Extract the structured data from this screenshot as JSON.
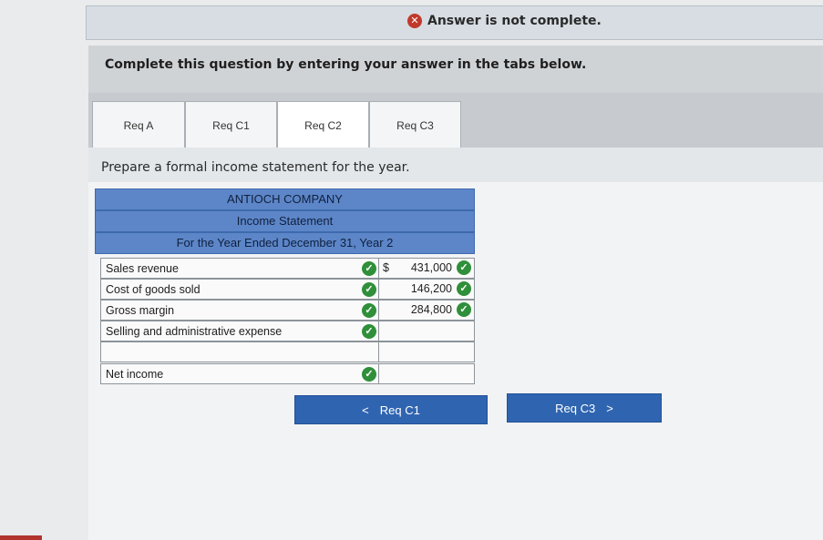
{
  "banner": {
    "status_text": "Answer is not complete.",
    "icon": "x-circle-icon"
  },
  "instruction": "Complete this question by entering your answer in the tabs below.",
  "tabs": [
    {
      "label": "Req A",
      "active": false
    },
    {
      "label": "Req C1",
      "active": false
    },
    {
      "label": "Req C2",
      "active": true
    },
    {
      "label": "Req C3",
      "active": false
    }
  ],
  "prompt": "Prepare a formal income statement for the year.",
  "statement": {
    "company": "ANTIOCH COMPANY",
    "title": "Income Statement",
    "period": "For the Year Ended December 31, Year 2",
    "rows": [
      {
        "label": "Sales revenue",
        "currency": "$",
        "value": "431,000"
      },
      {
        "label": "Cost of goods sold",
        "currency": "",
        "value": "146,200"
      },
      {
        "label": "Gross margin",
        "currency": "",
        "value": "284,800"
      },
      {
        "label": "Selling and administrative expense",
        "currency": "",
        "value": ""
      },
      {
        "label": "",
        "currency": "",
        "value": ""
      },
      {
        "label": "Net income",
        "currency": "",
        "value": ""
      }
    ]
  },
  "nav": {
    "prev_label": "Req C1",
    "prev_icon": "chevron-left-icon",
    "next_label": "Req C3",
    "next_icon": "chevron-right-icon"
  },
  "colors": {
    "header_blue": "#5d86c8",
    "button_blue": "#2f64b0",
    "check_green": "#2f8f3a",
    "error_red": "#c0392b"
  }
}
